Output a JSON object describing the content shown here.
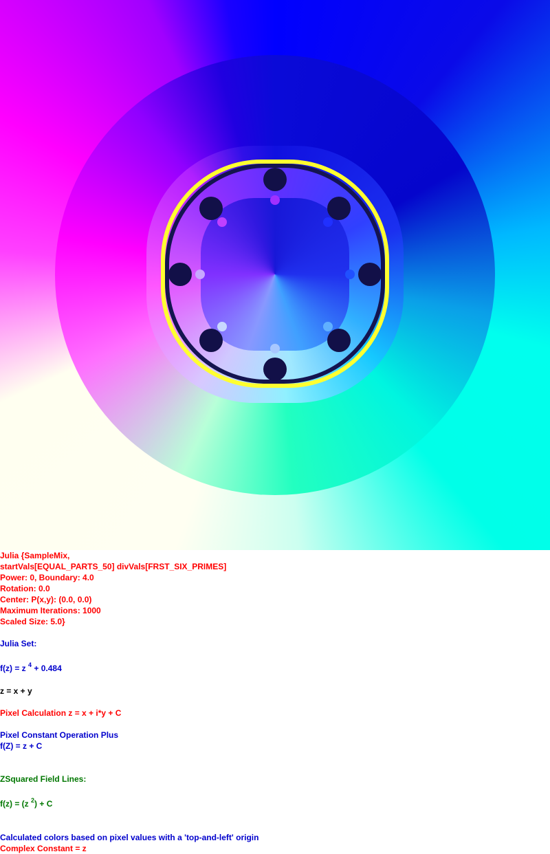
{
  "header_block": [
    "Julia {SampleMix,",
    "startVals[EQUAL_PARTS_50] divVals[FRST_SIX_PRIMES]",
    "Power: 0, Boundary: 4.0",
    "Rotation: 0.0",
    "Center: P(x,y): (0.0, 0.0)",
    "Maximum Iterations: 1000",
    "Scaled Size: 5.0}"
  ],
  "julia_set_label": "Julia Set:",
  "julia_formula": {
    "prefix": "f(z) = z",
    "exponent": "4",
    "suffix": " + 0.484"
  },
  "z_def": "z = x + y",
  "pixel_calc": "Pixel Calculation z = x + i*y + C",
  "pixel_op": {
    "title": "Pixel Constant Operation Plus",
    "formula": "f(Z) = z + C"
  },
  "field_lines_label": "ZSquared Field Lines:",
  "field_formula": {
    "prefix": "f(z) = (z",
    "exponent": "2",
    "suffix": ") + C"
  },
  "colors_note": "Calculated colors based on pixel values with a 'top-and-left' origin",
  "complex_constant": "Complex Constant = z",
  "colors": {
    "red_text": "#ff0000",
    "blue_text": "#0000cc",
    "green_text": "#007700",
    "yellow_band": "#ffff30"
  }
}
